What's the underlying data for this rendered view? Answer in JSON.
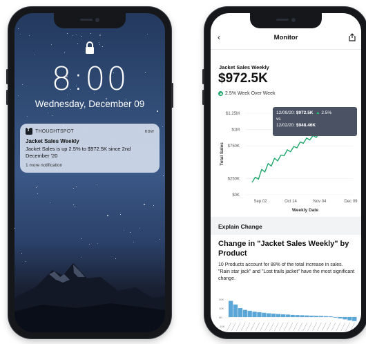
{
  "lock_screen": {
    "time": "8:00",
    "date": "Wednesday, December 09",
    "notification": {
      "app_name": "THOUGHTSPOT",
      "time": "now",
      "title": "Jacket Sales Weekly",
      "body": "Jacket Sales is up 2.5% to $972.5K since 2nd December '20",
      "more": "1 more notification"
    }
  },
  "monitor": {
    "nav": {
      "back_icon": "chevron-left-icon",
      "title": "Monitor",
      "share_icon": "share-icon"
    },
    "kpi": {
      "title": "Jacket Sales Weekly",
      "value": "$972.5K",
      "change": "2.5% Week Over Week"
    },
    "tooltip": {
      "date1": "12/09/20:",
      "value1": "$972.5K",
      "pct": "2.5%",
      "vs": "vs",
      "date2": "12/02/20:",
      "value2": "$948.46K"
    },
    "section": "Explain Change",
    "explain_title": "Change in \"Jacket Sales Weekly\" by Product",
    "explain_body": "10 Products account for 88% of the total increase in sales. \"Rain star jack\" and \"Lost trails jacket\" have the most significant change.",
    "colors": {
      "line": "#1ea76a",
      "bars": "#5aa6d6",
      "tooltip_bg": "#4a5263"
    }
  },
  "chart_data": {
    "type": "line",
    "xlabel": "Weekly Date",
    "ylabel": "Total Sales",
    "x_tick_labels": [
      "Sep 02",
      "Oct 14",
      "Nov 04",
      "Dec 09"
    ],
    "y_tick_labels": [
      "$1.25M",
      "$1M",
      "$750K",
      "$250K",
      "$0K"
    ],
    "ylim": [
      0,
      1250
    ],
    "series": [
      {
        "values": [
          190,
          270,
          240,
          390,
          350,
          480,
          440,
          560,
          520,
          610,
          600,
          690,
          660,
          740,
          720,
          810,
          790,
          870,
          840,
          910,
          880,
          950,
          930,
          980,
          960,
          990,
          970,
          950,
          960,
          975,
          948,
          972
        ]
      }
    ],
    "mini_bars": {
      "y_tick_labels": [
        "20K",
        "10K",
        "0K",
        "-10K"
      ],
      "values": [
        9,
        7,
        5,
        4,
        3.5,
        3,
        2.7,
        2.4,
        2.1,
        1.9,
        1.7,
        1.5,
        1.4,
        1.2,
        1.1,
        1,
        0.9,
        0.8,
        0.7,
        0.6,
        0.5,
        0.4,
        -0.3,
        -0.8,
        -1.3,
        -1.8,
        -2.2
      ]
    }
  }
}
